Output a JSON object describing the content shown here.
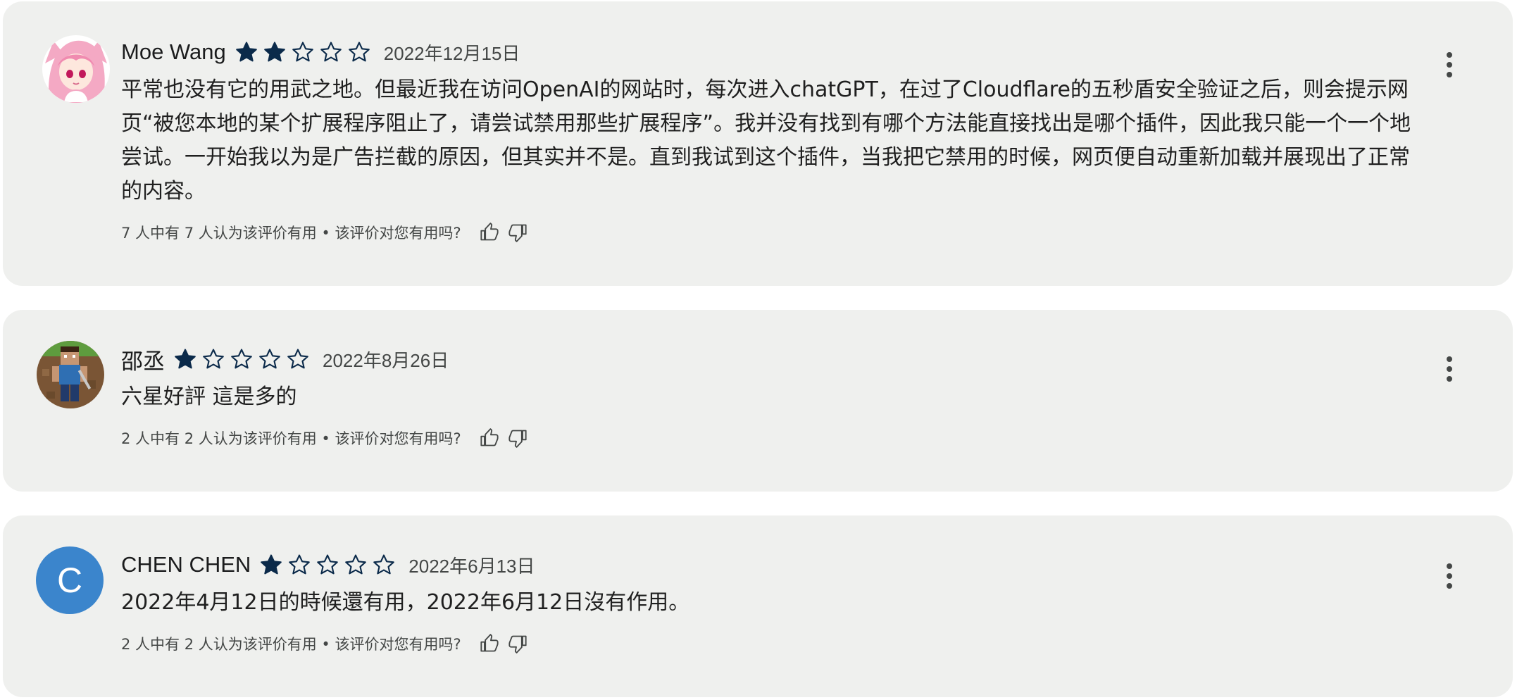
{
  "reviews": [
    {
      "author": "Moe Wang",
      "rating": 2,
      "max_rating": 5,
      "date": "2022年12月15日",
      "avatar": "anime-girl-avatar",
      "text": "平常也没有它的用武之地。但最近我在访问OpenAI的网站时，每次进入chatGPT，在过了Cloudflare的五秒盾安全验证之后，则会提示网页“被您本地的某个扩展程序阻止了，请尝试禁用那些扩展程序”。我并没有找到有哪个方法能直接找出是哪个插件，因此我只能一个一个地尝试。一开始我以为是广告拦截的原因，但其实并不是。直到我试到这个插件，当我把它禁用的时候，网页便自动重新加载并展现出了正常的内容。",
      "helpful": "7 人中有 7 人认为该评价有用 • 该评价对您有用吗?"
    },
    {
      "author": "邵丞",
      "rating": 1,
      "max_rating": 5,
      "date": "2022年8月26日",
      "avatar": "pixel-character-avatar",
      "text": "六星好評 這是多的",
      "helpful": "2 人中有 2 人认为该评价有用 • 该评价对您有用吗?"
    },
    {
      "author": "CHEN CHEN",
      "rating": 1,
      "max_rating": 5,
      "date": "2022年6月13日",
      "avatar": "letter-avatar",
      "avatar_letter": "C",
      "text": "2022年4月12日的時候還有用，2022年6月12日沒有作用。",
      "helpful": "2 人中有 2 人认为该评价有用 • 该评价对您有用吗?"
    }
  ],
  "icons": {
    "more": "more-vert-icon",
    "thumb_up": "thumb-up-icon",
    "thumb_down": "thumb-down-icon",
    "star_filled": "star-filled-icon",
    "star_empty": "star-outline-icon"
  },
  "colors": {
    "card_background": "#eff0ee",
    "star": "#0b2a4a",
    "avatar_letter_bg": "#3b85cc"
  }
}
